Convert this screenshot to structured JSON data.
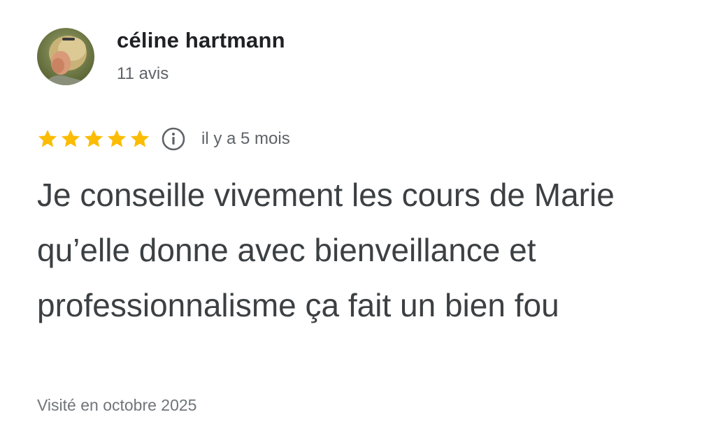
{
  "review": {
    "author": {
      "name": "céline hartmann",
      "review_count": "11 avis",
      "avatar_icon": "profile-photo-avatar"
    },
    "rating": {
      "stars": 5,
      "max_stars": 5,
      "star_color": "#fbbc04",
      "info_icon": "info-circle-icon"
    },
    "relative_date": "il y a 5 mois",
    "text": "Je conseille vivement les cours de Marie qu’elle donne avec bienveillance et professionnalisme ça fait un bien fou",
    "visit": "Visité en octobre 2025"
  }
}
